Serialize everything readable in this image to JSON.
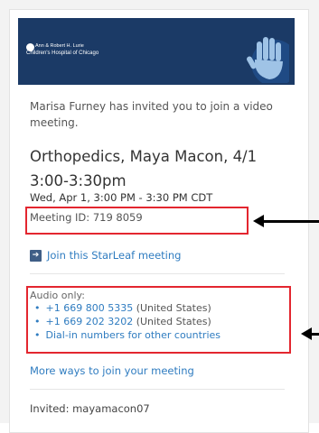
{
  "header": {
    "logo_line1": "Ann & Robert H. Lurie",
    "logo_line2": "Children's Hospital of Chicago",
    "hand_icon": "raised-hand-icon"
  },
  "invite_text": "Marisa Furney has invited you to join a video meeting.",
  "meeting": {
    "title": "Orthopedics, Maya Macon, 4/1 3:00-3:30pm",
    "datetime": "Wed, Apr 1, 3:00 PM - 3:30 PM CDT",
    "id_label": "Meeting ID:",
    "id_value": "719 8059"
  },
  "join": {
    "icon": "arrow-right-icon",
    "label": "Join this StarLeaf meeting"
  },
  "audio": {
    "label": "Audio only:",
    "numbers": [
      {
        "number": "+1 669 800 5335",
        "country": "(United States)"
      },
      {
        "number": "+1 669 202 3202",
        "country": "(United States)"
      }
    ],
    "other_countries": "Dial-in numbers for other countries"
  },
  "more_ways": "More ways to join your meeting",
  "invited": "Invited: mayamacon07",
  "colors": {
    "header": "#1b3a66",
    "link": "#2f7cc0",
    "highlight": "#e3262f"
  }
}
